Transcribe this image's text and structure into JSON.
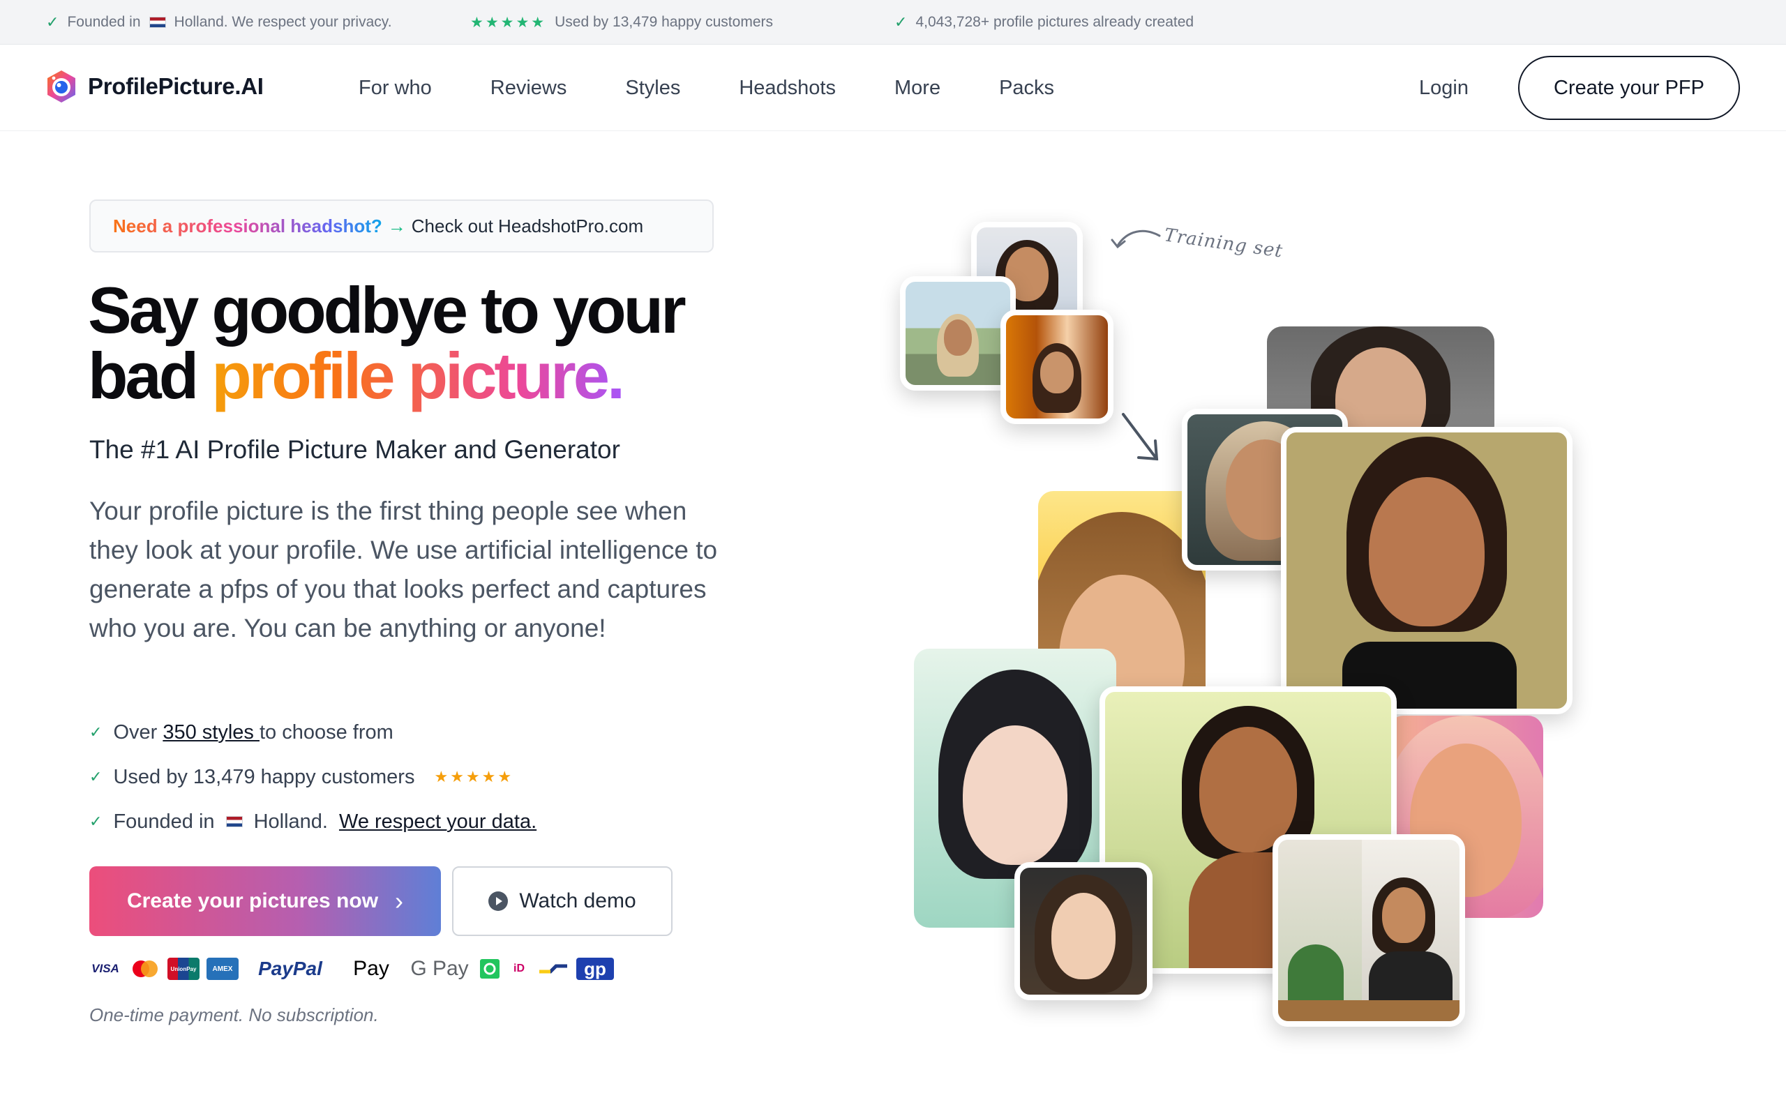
{
  "topbar": {
    "founded_prefix": "Founded in",
    "founded_suffix": "Holland. We respect your privacy.",
    "customers": "Used by 13,479 happy customers",
    "pictures": "4,043,728+ profile pictures already created",
    "stars": "★★★★★"
  },
  "nav": {
    "logo": "ProfilePicture.AI",
    "menu": [
      "For who",
      "Reviews",
      "Styles",
      "Headshots",
      "More",
      "Packs"
    ],
    "login": "Login",
    "cta": "Create your PFP"
  },
  "hero": {
    "promo_question": "Need a professional headshot?",
    "promo_arrow": "→",
    "promo_link": "Check out HeadshotPro.com",
    "headline_line1": "Say goodbye to your",
    "headline_line2_plain": "bad ",
    "headline_line2_accent": "profile picture.",
    "subtitle": "The #1 AI Profile Picture Maker and Generator",
    "description": "Your profile picture is the first thing people see when they look at your profile. We use artificial intelligence to generate a pfps of you that looks perfect and captures who you are. You can be anything or anyone!",
    "bullets": {
      "b1_prefix": "Over ",
      "b1_link": "350 styles ",
      "b1_suffix": "to choose from",
      "b2": "Used by 13,479 happy customers",
      "b2_stars": "★★★★★",
      "b3_prefix": "Founded in",
      "b3_middle": "Holland.",
      "b3_link": "We respect your data."
    },
    "primary_button": "Create your pictures now",
    "primary_chevron": "›",
    "secondary_button": "Watch demo",
    "payments": {
      "visa": "VISA",
      "unionpay": "UnionPay",
      "amex": "AMEX",
      "paypal": "PayPal",
      "applepay": " Pay",
      "gpay": "G Pay",
      "ideal": "iD",
      "gp": "gp"
    },
    "note": "One-time payment. No subscription.",
    "training_label": "Training set"
  },
  "colors": {
    "check_green": "#22a06b",
    "star_orange": "#f59e0b",
    "cta_gradient_start": "#ec4e7b",
    "cta_gradient_end": "#5f7fd6"
  }
}
